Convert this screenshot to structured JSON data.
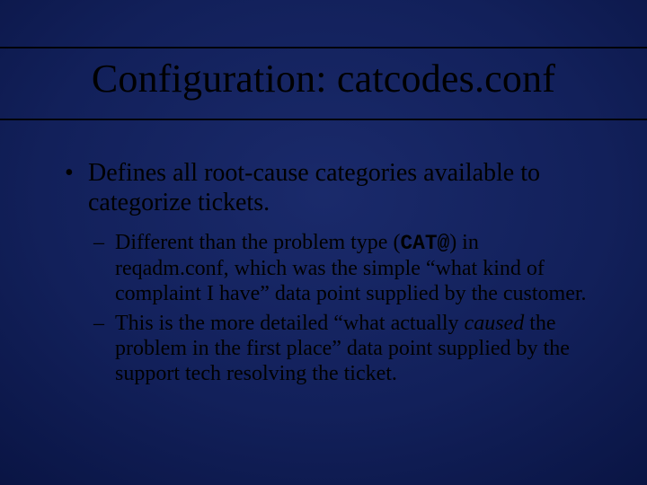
{
  "title": "Configuration: catcodes.conf",
  "bullet1": "Defines all root-cause categories available to categorize tickets.",
  "sub1_pre": "Different than the problem type (",
  "sub1_code": "CAT@",
  "sub1_post": ") in reqadm.conf, which was the simple “what kind of complaint I have” data point supplied by the customer.",
  "sub2_pre": "This is the more detailed “what actually ",
  "sub2_em": "caused",
  "sub2_post": " the problem in the first place” data point supplied by the support tech resolving the ticket."
}
